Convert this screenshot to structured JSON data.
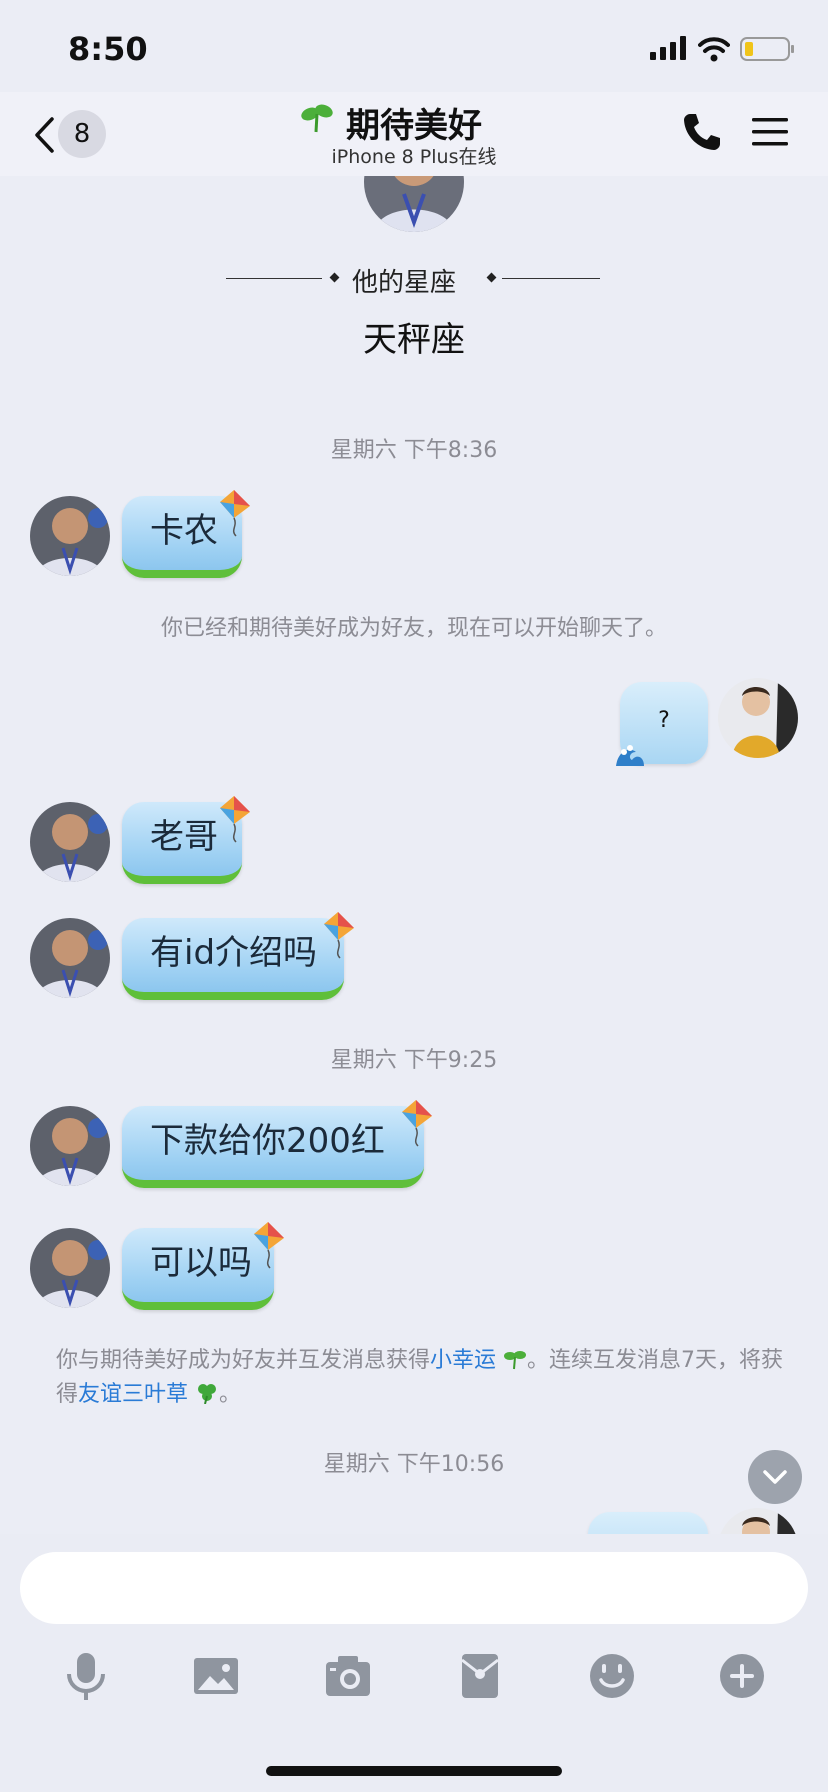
{
  "status_bar": {
    "time": "8:50"
  },
  "header": {
    "back_count": "8",
    "title": "期待美好",
    "subtitle": "iPhone 8 Plus在线"
  },
  "profile": {
    "zodiac_label": "他的星座",
    "zodiac_value": "天秤座"
  },
  "messages": [
    {
      "type": "timestamp",
      "text": "星期六 下午8:36"
    },
    {
      "type": "incoming",
      "text": "卡农"
    },
    {
      "type": "system",
      "text": "你已经和期待美好成为好友，现在可以开始聊天了。"
    },
    {
      "type": "outgoing",
      "text": "?"
    },
    {
      "type": "incoming",
      "text": "老哥"
    },
    {
      "type": "incoming",
      "text": "有id介绍吗"
    },
    {
      "type": "timestamp",
      "text": "星期六 下午9:25"
    },
    {
      "type": "incoming",
      "text": "下款给你200红"
    },
    {
      "type": "incoming",
      "text": "可以吗"
    },
    {
      "type": "timestamp",
      "text": "星期六 下午10:56"
    }
  ],
  "friendship_notice": {
    "part1": "你与期待美好成为好友并互发消息获得",
    "link1": "小幸运",
    "part2": "。连续互发消息7天，将获得",
    "link2": "友谊三叶草",
    "part3": "。"
  },
  "input": {
    "placeholder": ""
  },
  "toolbar": [
    "mic-icon",
    "image-icon",
    "camera-icon",
    "red-packet-icon",
    "emoji-icon",
    "plus-icon"
  ],
  "colors": {
    "link": "#2a7bd6",
    "bubble_grass": "#5fbf3a",
    "background": "#ebedf5"
  }
}
